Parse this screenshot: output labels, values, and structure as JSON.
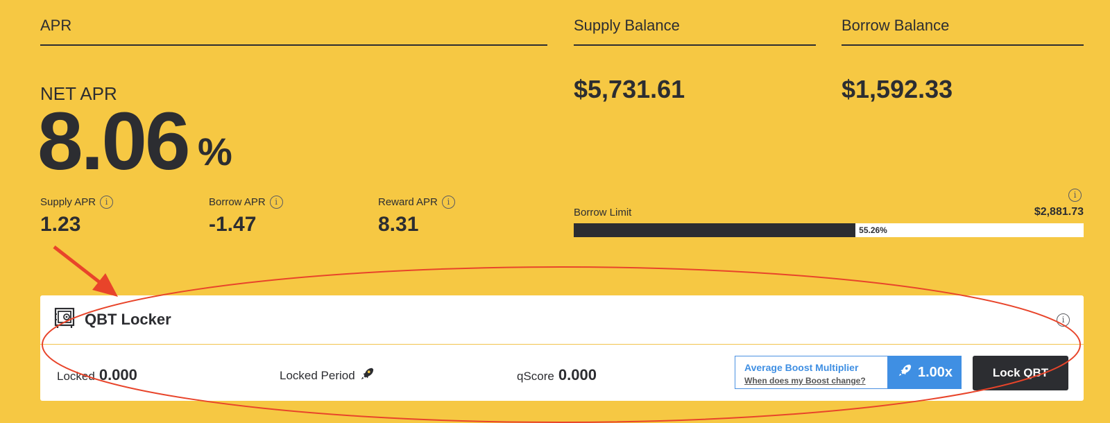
{
  "apr": {
    "title": "APR",
    "net_label": "NET APR",
    "net_value": "8.06",
    "net_unit": "%",
    "supply_label": "Supply APR",
    "supply_value": "1.23",
    "borrow_label": "Borrow APR",
    "borrow_value": "-1.47",
    "reward_label": "Reward APR",
    "reward_value": "8.31"
  },
  "supply_balance": {
    "title": "Supply Balance",
    "value": "$5,731.61"
  },
  "borrow_balance": {
    "title": "Borrow Balance",
    "value": "$1,592.33"
  },
  "borrow_limit": {
    "label": "Borrow Limit",
    "amount": "$2,881.73",
    "percent_text": "55.26%",
    "percent": 55.26
  },
  "locker": {
    "title": "QBT Locker",
    "locked_label": "Locked",
    "locked_value": "0.000",
    "period_label": "Locked Period",
    "qscore_label": "qScore",
    "qscore_value": "0.000",
    "boost_title": "Average Boost Multiplier",
    "boost_link": "When does my Boost change?",
    "boost_value": "1.00x",
    "lock_button": "Lock QBT"
  },
  "info_glyph": "i",
  "colors": {
    "background": "#f6c843",
    "dark": "#2c2d31",
    "accent_blue": "#3f8fe3",
    "annotation_red": "#e8442a"
  }
}
